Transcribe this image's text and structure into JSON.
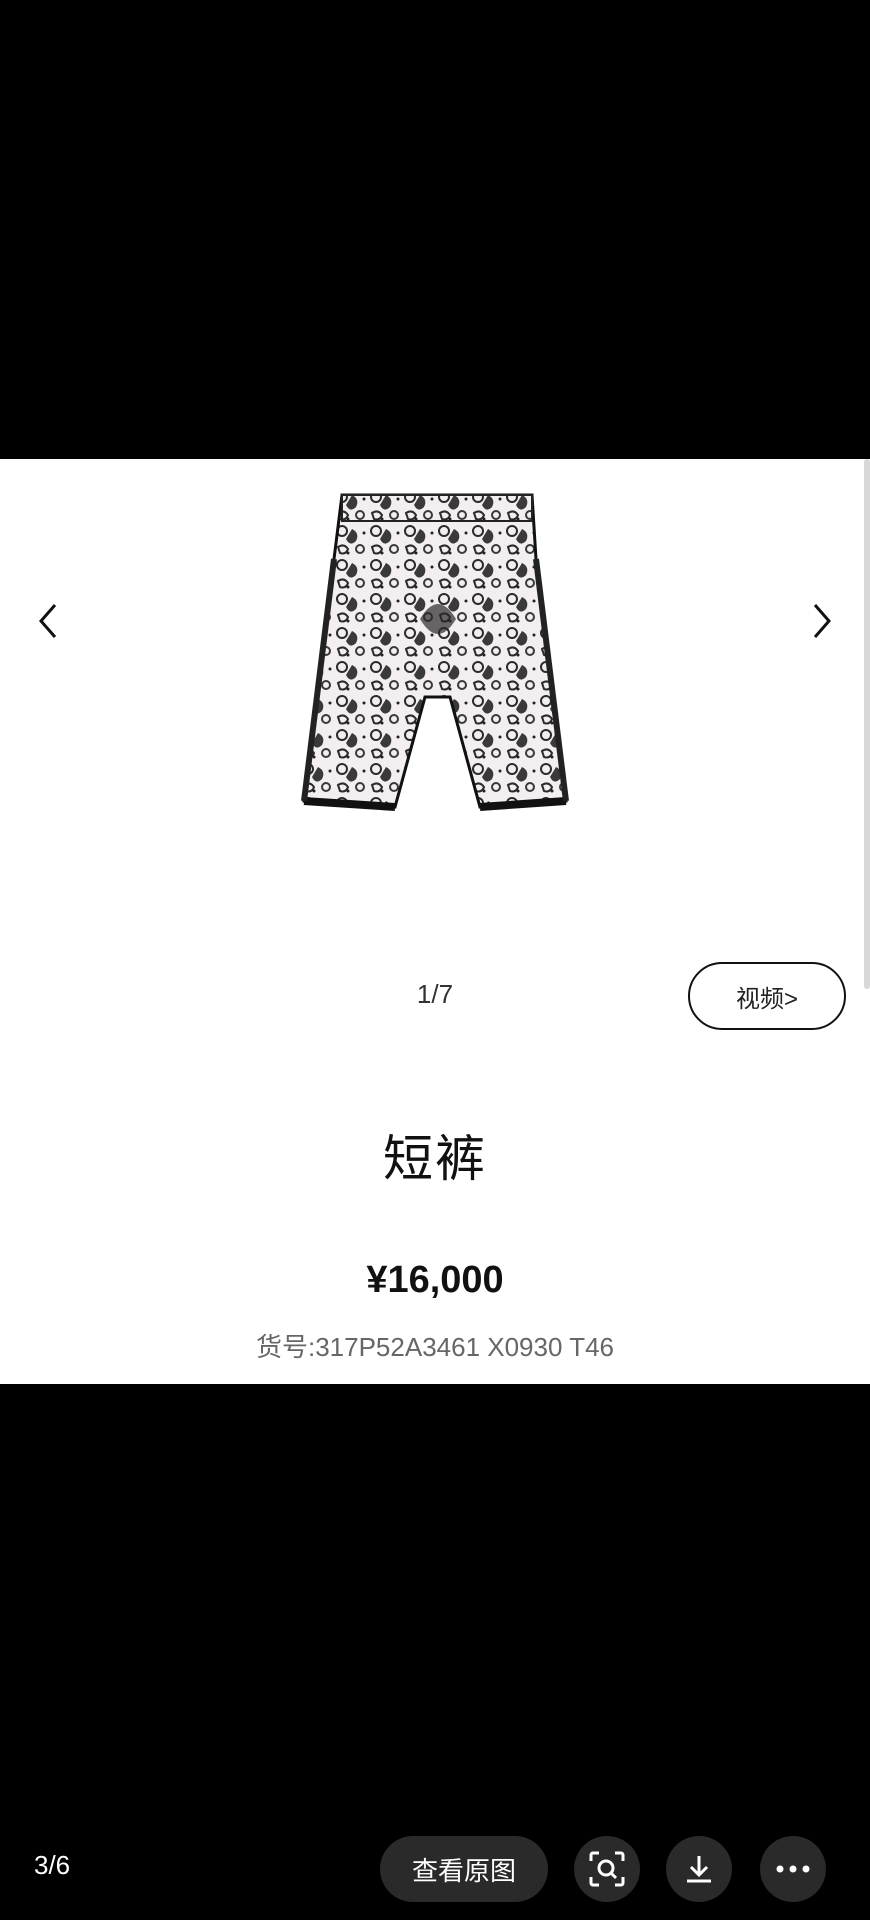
{
  "viewer": {
    "page_indicator": "3/6",
    "view_original_label": "查看原图",
    "buttons": [
      "image-search",
      "download",
      "more"
    ]
  },
  "product": {
    "image_counter": "1/7",
    "video_label": "视频>",
    "title": "短裤",
    "price": "¥16,000",
    "sku": "货号:317P52A3461 X0930 T46"
  }
}
